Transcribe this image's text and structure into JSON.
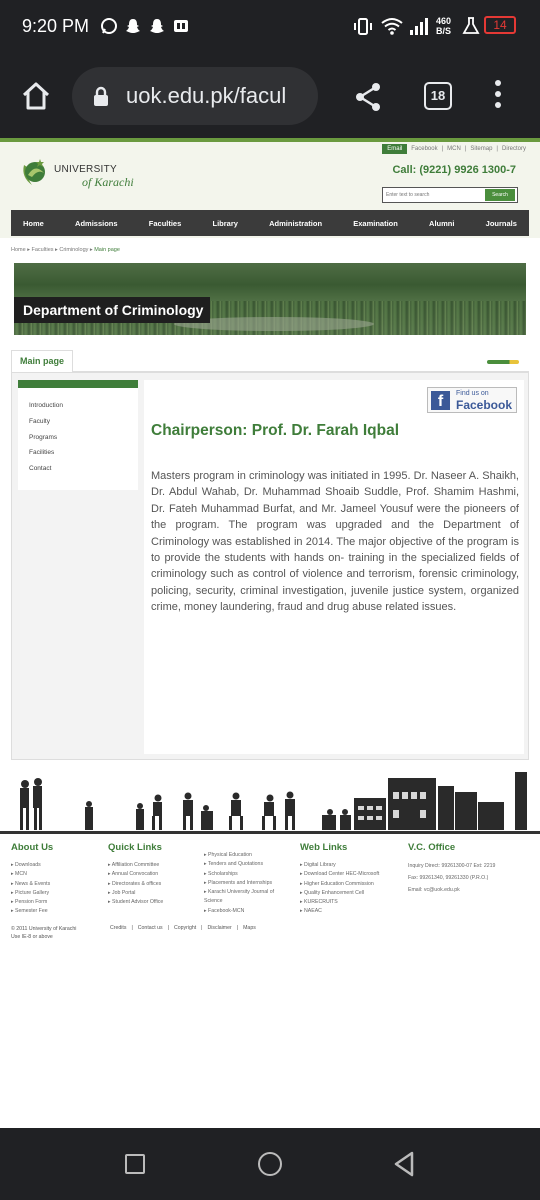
{
  "status_bar": {
    "time": "9:20 PM",
    "net_speed_value": "460",
    "net_speed_unit": "B/S",
    "battery": "14"
  },
  "browser": {
    "url": "uok.edu.pk/facul",
    "tab_count": "18"
  },
  "site": {
    "top_links": [
      "Email",
      "Facebook",
      "MCN",
      "Sitemap",
      "Directory"
    ],
    "logo_line1": "UNIVERSITY",
    "logo_line2": "of Karachi",
    "call": "Call: (9221) 9926 1300-7",
    "search_placeholder": "Enter text to search",
    "search_button": "Search",
    "nav": [
      "Home",
      "Admissions",
      "Faculties",
      "Library",
      "Administration",
      "Examination",
      "Alumni",
      "Journals"
    ],
    "breadcrumb": [
      "Home",
      "Faculties",
      "Criminology",
      "Main page"
    ],
    "banner_title": "Department of Criminology",
    "tab_label": "Main page",
    "sidebar": [
      "Introduction",
      "Faculty",
      "Programs",
      "Facilities",
      "Contact"
    ],
    "facebook": {
      "small": "Find us on",
      "big": "Facebook"
    },
    "chairperson": "Chairperson: Prof. Dr. Farah Iqbal",
    "paragraph": "Masters program in criminology was initiated in 1995. Dr. Naseer A. Shaikh, Dr. Abdul Wahab, Dr. Muhammad Shoaib Suddle, Prof. Shamim Hashmi, Dr. Fateh Muhammad Burfat, and Mr. Jameel Yousuf were the pioneers of the program. The program was upgraded and the Department of Criminology was established in 2014. The major objective of the program is to provide the students with hands on- training in the specialized fields of criminology such as control of violence and terrorism, forensic criminology, policing, security, criminal investigation, juvenile justice system, organized crime, money laundering, fraud and drug abuse related issues."
  },
  "footer": {
    "about_head": "About Us",
    "about": [
      "Downloads",
      "MCN",
      "News & Events",
      "Picture Gallery",
      "Pension Form",
      "Semester Fee"
    ],
    "quick_head": "Quick Links",
    "quick1": [
      "Affiliation Committee",
      "Annual Convocation",
      "Directorates & offices",
      "Job Portal",
      "Student Advisor Office"
    ],
    "quick2": [
      "Physical Education",
      "Tenders and Quotations",
      "Scholarships",
      "Placements and Internships",
      "Karachi University Journal of Science",
      "Facebook-MCN"
    ],
    "web_head": "Web Links",
    "web": [
      "Digital Library",
      "Download Center HEC-Microsoft",
      "Higher Education Commission",
      "Quality Enhancement Cell",
      "KURECRUITS",
      "NAEAC"
    ],
    "vc_head": "V.C. Office",
    "vc": [
      "Inquiry Direct: 99261300-07 Ext: 2219",
      "Fax: 99261340, 99261330 (P.R.O.)",
      "Email: vc@uok.edu.pk"
    ],
    "copyright": [
      "© 2011 University of Karachi",
      "Use IE-8 or above"
    ],
    "bottom_links": [
      "Credits",
      "Contact us",
      "Copyright",
      "Disclaimer",
      "Maps"
    ]
  }
}
